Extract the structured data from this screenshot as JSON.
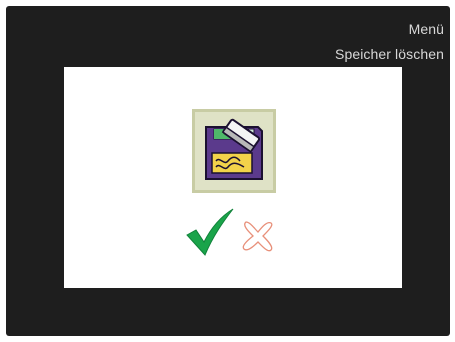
{
  "header": {
    "menu_title": "Menü",
    "screen_title": "Speicher löschen"
  },
  "dialog": {
    "icon": "erase-memory-icon",
    "confirm_icon": "checkmark-icon",
    "cancel_icon": "cross-icon",
    "selected": "confirm"
  },
  "colors": {
    "screen_background": "#1e1e1e",
    "panel_background": "#ffffff",
    "header_text": "#d8d8d8",
    "confirm_green": "#1aa44a",
    "cancel_outline": "#e8907a",
    "icon_frame": "#c8cca4",
    "icon_body": "#5b3a8c",
    "icon_label": "#f2d24a"
  }
}
